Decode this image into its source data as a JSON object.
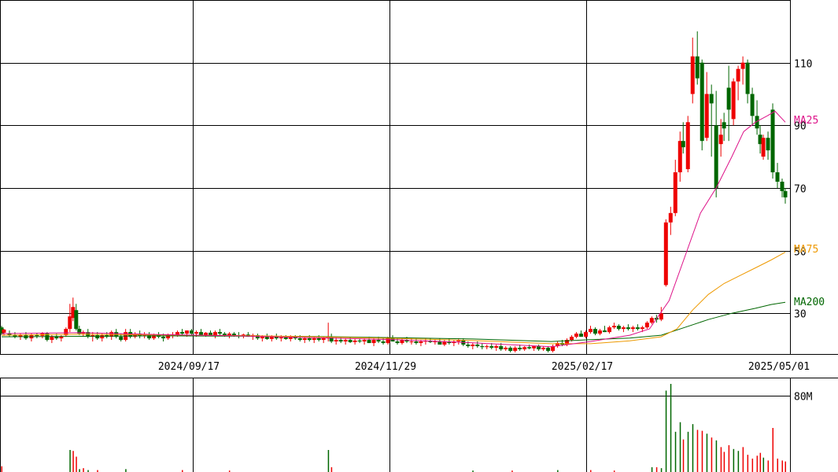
{
  "chart_data": {
    "type": "candlestick",
    "x_ticks": [
      "2024/09/17",
      "2024/11/29",
      "2025/02/17",
      "2025/05/01"
    ],
    "price_axis": {
      "ticks": [
        30,
        50,
        70,
        90,
        110
      ],
      "ylim": [
        17,
        130
      ]
    },
    "volume_axis": {
      "ticks": [
        "80M"
      ],
      "tick_values": [
        80
      ],
      "ylim": [
        0,
        92
      ]
    },
    "ma_labels": [
      "MA25",
      "MA75",
      "MA200"
    ],
    "colors": {
      "up": "#ee0000",
      "down": "#006600",
      "ma25": "#dd1188",
      "ma75": "#ee9900",
      "ma200": "#006600",
      "grid": "#000000"
    },
    "candles": [
      [
        0,
        25.5,
        26,
        23,
        23.5
      ],
      [
        3,
        23.8,
        25,
        22.8,
        24.8
      ],
      [
        10,
        23.5,
        24.5,
        22.5,
        23
      ],
      [
        17,
        23,
        24,
        22,
        22.5
      ],
      [
        24,
        22.5,
        23.5,
        21.5,
        23
      ],
      [
        31,
        23,
        24,
        21.5,
        22
      ],
      [
        38,
        22,
        23.5,
        21,
        23
      ],
      [
        45,
        23,
        23.8,
        22,
        22.8
      ],
      [
        52,
        22.8,
        24,
        22,
        23.5
      ],
      [
        58,
        23.5,
        24,
        21,
        21.5
      ],
      [
        64,
        21.5,
        23,
        20.5,
        22.5
      ],
      [
        70,
        22.5,
        23.5,
        21.5,
        22
      ],
      [
        76,
        22,
        23,
        21,
        22.5
      ],
      [
        82,
        23,
        25.5,
        22.5,
        25
      ],
      [
        87,
        25,
        33,
        24,
        29
      ],
      [
        91,
        28.5,
        35,
        27.5,
        32
      ],
      [
        95,
        31,
        33,
        24.5,
        25
      ],
      [
        99,
        25,
        26,
        23,
        23.5
      ],
      [
        104,
        23.5,
        24.5,
        22.5,
        24
      ],
      [
        110,
        24,
        25,
        22,
        22.5
      ],
      [
        116,
        22.5,
        24,
        21,
        23
      ],
      [
        122,
        23,
        24,
        21.5,
        22
      ],
      [
        128,
        22,
        23.5,
        21,
        23
      ],
      [
        134,
        23,
        24,
        22,
        22.5
      ],
      [
        140,
        22.5,
        24.5,
        21.5,
        24
      ],
      [
        146,
        24,
        25,
        22,
        22.5
      ],
      [
        152,
        22.5,
        23.5,
        21,
        21.5
      ],
      [
        158,
        21.5,
        25,
        21,
        24
      ],
      [
        164,
        24,
        25,
        22,
        22.5
      ],
      [
        170,
        22.5,
        24,
        22,
        23.5
      ],
      [
        176,
        23.5,
        24.5,
        22,
        22.8
      ],
      [
        182,
        22.8,
        24,
        22,
        23
      ],
      [
        188,
        23,
        24,
        21.5,
        22
      ],
      [
        194,
        22,
        23.5,
        21.5,
        23
      ],
      [
        200,
        23,
        24,
        22,
        22.5
      ],
      [
        206,
        22.5,
        23.5,
        21,
        22
      ],
      [
        212,
        22,
        23.5,
        21.5,
        23
      ],
      [
        218,
        23,
        24,
        22,
        23.2
      ],
      [
        224,
        23.2,
        24.5,
        22.5,
        24
      ],
      [
        230,
        24,
        25,
        23,
        23.5
      ],
      [
        236,
        23.5,
        24.5,
        22.5,
        24.5
      ],
      [
        242,
        24.5,
        25,
        23,
        23.5
      ],
      [
        248,
        23.5,
        24.5,
        22.5,
        24
      ],
      [
        254,
        24,
        25,
        23,
        23
      ],
      [
        260,
        23,
        24,
        22.5,
        23.8
      ],
      [
        266,
        23.8,
        24.5,
        22.8,
        23
      ],
      [
        272,
        23,
        24.5,
        22,
        24
      ],
      [
        278,
        24,
        25,
        23,
        23.5
      ],
      [
        284,
        23.5,
        24,
        22.5,
        22.8
      ],
      [
        290,
        22.8,
        24,
        22,
        23.5
      ],
      [
        296,
        23.5,
        24,
        22.5,
        23
      ],
      [
        302,
        23,
        24,
        22,
        22.8
      ],
      [
        308,
        22.8,
        23.5,
        22,
        23.2
      ],
      [
        314,
        23.2,
        24,
        22.5,
        22.5
      ],
      [
        320,
        22.5,
        23.5,
        21.5,
        23
      ],
      [
        326,
        23,
        23.5,
        21.5,
        22
      ],
      [
        332,
        22,
        23,
        21,
        22.5
      ],
      [
        338,
        22.5,
        23.5,
        21.5,
        21.8
      ],
      [
        344,
        21.8,
        23,
        21,
        22.5
      ],
      [
        350,
        22.5,
        23.5,
        21.5,
        22
      ],
      [
        356,
        22,
        23,
        21,
        22.3
      ],
      [
        362,
        22.3,
        23,
        21.5,
        21.8
      ],
      [
        368,
        21.8,
        23,
        21,
        22.5
      ],
      [
        374,
        22.5,
        23,
        21.5,
        22
      ],
      [
        380,
        22,
        23,
        21,
        21.5
      ],
      [
        386,
        21.5,
        22.5,
        20.5,
        22
      ],
      [
        392,
        22,
        23,
        21,
        21.5
      ],
      [
        398,
        21.5,
        22.5,
        20.5,
        22
      ],
      [
        404,
        22,
        23,
        21,
        21.5
      ],
      [
        410,
        21.5,
        22.5,
        20.5,
        22
      ],
      [
        416,
        22,
        27,
        21,
        22.5
      ],
      [
        420,
        22.5,
        23.5,
        20.5,
        21
      ],
      [
        426,
        21,
        22.5,
        20,
        21.5
      ],
      [
        432,
        21.5,
        22.5,
        20.5,
        21
      ],
      [
        438,
        21,
        22,
        20,
        21.5
      ],
      [
        444,
        21.5,
        22.5,
        20.5,
        20.8
      ],
      [
        450,
        20.8,
        22,
        20,
        21.3
      ],
      [
        456,
        21.3,
        22,
        20.5,
        21
      ],
      [
        462,
        21,
        22,
        20,
        21.5
      ],
      [
        468,
        21.5,
        22.5,
        20.5,
        20.5
      ],
      [
        474,
        20.5,
        22,
        19.5,
        21.5
      ],
      [
        480,
        21.5,
        22.5,
        20.5,
        21
      ],
      [
        486,
        21,
        22,
        20,
        20.5
      ],
      [
        492,
        20.5,
        22.5,
        20,
        22
      ],
      [
        498,
        22,
        23,
        21,
        21
      ],
      [
        504,
        21,
        22,
        20,
        20.5
      ],
      [
        510,
        20.5,
        22,
        20,
        21.5
      ],
      [
        516,
        21.5,
        22.5,
        20.5,
        21
      ],
      [
        522,
        21,
        22,
        20,
        21
      ],
      [
        528,
        21,
        22,
        20,
        20.5
      ],
      [
        534,
        20.5,
        21.5,
        19.5,
        21
      ],
      [
        540,
        21,
        22,
        20,
        21.2
      ],
      [
        546,
        21.2,
        22,
        20.5,
        20.8
      ],
      [
        552,
        20.8,
        21.5,
        20,
        21
      ],
      [
        558,
        21,
        22,
        20.5,
        20
      ],
      [
        564,
        20,
        21.5,
        19.5,
        21
      ],
      [
        570,
        21,
        22,
        20,
        20.5
      ],
      [
        576,
        20.5,
        21.5,
        19.5,
        21
      ],
      [
        582,
        21,
        22,
        20,
        21.5
      ],
      [
        588,
        21.5,
        22,
        19.5,
        20
      ],
      [
        594,
        20,
        21,
        19,
        19.5
      ],
      [
        600,
        19.5,
        20.5,
        18.5,
        20
      ],
      [
        606,
        20,
        21,
        19,
        19.5
      ],
      [
        612,
        19.5,
        20.5,
        18.5,
        19.2
      ],
      [
        618,
        19.2,
        20,
        18.5,
        19.5
      ],
      [
        624,
        19.5,
        20.5,
        18.5,
        19
      ],
      [
        630,
        19,
        20,
        18,
        19.5
      ],
      [
        636,
        19.5,
        20.5,
        18,
        18.5
      ],
      [
        642,
        18.5,
        19.5,
        18,
        19
      ],
      [
        648,
        19,
        19.5,
        17.5,
        18
      ],
      [
        654,
        18,
        19.5,
        17.5,
        19
      ],
      [
        660,
        19,
        20,
        18,
        18.5
      ],
      [
        666,
        18.5,
        19.5,
        18,
        19.2
      ],
      [
        672,
        19.2,
        20,
        18.5,
        18.8
      ],
      [
        678,
        18.8,
        19.5,
        18,
        19.5
      ],
      [
        684,
        19.5,
        20,
        18,
        18.5
      ],
      [
        690,
        18.5,
        19.5,
        18,
        19
      ],
      [
        696,
        19,
        19.5,
        17.5,
        18
      ],
      [
        702,
        18,
        20,
        17.5,
        19.5
      ],
      [
        708,
        19.5,
        21,
        19,
        20.5
      ],
      [
        714,
        20.5,
        21.5,
        19.5,
        20
      ],
      [
        720,
        20,
        22,
        19.5,
        21.5
      ],
      [
        726,
        21.5,
        23,
        21,
        22.5
      ],
      [
        732,
        22.5,
        24,
        22,
        23.5
      ],
      [
        738,
        23.5,
        24.5,
        22.5,
        22.5
      ],
      [
        744,
        22.5,
        24.5,
        22,
        24
      ],
      [
        750,
        24,
        26,
        23.5,
        25
      ],
      [
        756,
        25,
        25.5,
        23,
        23.5
      ],
      [
        762,
        23.5,
        25,
        23,
        24.5
      ],
      [
        768,
        24.5,
        26,
        24,
        24
      ],
      [
        774,
        24,
        26,
        23.5,
        25.5
      ],
      [
        780,
        25.5,
        27,
        25,
        26
      ],
      [
        786,
        26,
        26.5,
        24.5,
        25
      ],
      [
        792,
        25,
        26,
        24,
        25.5
      ],
      [
        798,
        25.5,
        26.5,
        24.5,
        25
      ],
      [
        804,
        25,
        26,
        24,
        25.5
      ],
      [
        810,
        25.5,
        26.5,
        24.5,
        25
      ],
      [
        816,
        25,
        26,
        24,
        25.5
      ],
      [
        822,
        25.5,
        27.5,
        25,
        27
      ],
      [
        828,
        27,
        29,
        26.5,
        28.5
      ],
      [
        834,
        28.5,
        29.5,
        27,
        28
      ],
      [
        840,
        28,
        32,
        27.5,
        30
      ],
      [
        846,
        39,
        60,
        38.5,
        59
      ],
      [
        852,
        59,
        64,
        55,
        62
      ],
      [
        858,
        62,
        79,
        61,
        75
      ],
      [
        864,
        75,
        88,
        72,
        85
      ],
      [
        868,
        85,
        91,
        81,
        83
      ],
      [
        874,
        76,
        93,
        75,
        91
      ],
      [
        880,
        100,
        118,
        97,
        112
      ],
      [
        886,
        112,
        120,
        103,
        105
      ],
      [
        892,
        110,
        111,
        82,
        85
      ],
      [
        898,
        86,
        107,
        85,
        100
      ],
      [
        904,
        100,
        103,
        80,
        97
      ],
      [
        910,
        90,
        101,
        67,
        70
      ],
      [
        916,
        84,
        92,
        80,
        87
      ],
      [
        920,
        91,
        94,
        85,
        89
      ],
      [
        926,
        102,
        109,
        85,
        95
      ],
      [
        932,
        92,
        105,
        90,
        104
      ],
      [
        938,
        104,
        109,
        98,
        108
      ],
      [
        944,
        108,
        112,
        103,
        110
      ],
      [
        950,
        110,
        111,
        97,
        100
      ],
      [
        956,
        100,
        102,
        90,
        93
      ],
      [
        962,
        93,
        98,
        87,
        89
      ],
      [
        966,
        87,
        90,
        81,
        84
      ],
      [
        970,
        80,
        87,
        79,
        86
      ],
      [
        976,
        86,
        88,
        79,
        82
      ],
      [
        982,
        95,
        97,
        73,
        75
      ],
      [
        988,
        75,
        78,
        70,
        72
      ],
      [
        994,
        72,
        73,
        67,
        69
      ],
      [
        998,
        69,
        70,
        65,
        67
      ]
    ],
    "ma25": [
      [
        0,
        23.5
      ],
      [
        100,
        23.8
      ],
      [
        200,
        23.2
      ],
      [
        300,
        22.8
      ],
      [
        400,
        22.2
      ],
      [
        500,
        21.6
      ],
      [
        600,
        20.6
      ],
      [
        700,
        19.3
      ],
      [
        750,
        21
      ],
      [
        800,
        23
      ],
      [
        825,
        25
      ],
      [
        850,
        34
      ],
      [
        870,
        48
      ],
      [
        890,
        62
      ],
      [
        910,
        70
      ],
      [
        930,
        80
      ],
      [
        945,
        88
      ],
      [
        960,
        91
      ],
      [
        975,
        93
      ],
      [
        985,
        94.5
      ],
      [
        998,
        91
      ]
    ],
    "ma75": [
      [
        0,
        23
      ],
      [
        100,
        23.3
      ],
      [
        200,
        23.1
      ],
      [
        300,
        22.9
      ],
      [
        400,
        22.5
      ],
      [
        500,
        22
      ],
      [
        600,
        21.3
      ],
      [
        700,
        20.3
      ],
      [
        750,
        20.3
      ],
      [
        800,
        21.2
      ],
      [
        840,
        22.5
      ],
      [
        860,
        25
      ],
      [
        880,
        31
      ],
      [
        900,
        36
      ],
      [
        920,
        39.5
      ],
      [
        940,
        42
      ],
      [
        960,
        44.5
      ],
      [
        980,
        47
      ],
      [
        998,
        49.5
      ]
    ],
    "ma200": [
      [
        0,
        22.5
      ],
      [
        200,
        22.8
      ],
      [
        400,
        22.6
      ],
      [
        600,
        21.8
      ],
      [
        700,
        21
      ],
      [
        750,
        21.6
      ],
      [
        800,
        22.1
      ],
      [
        840,
        23
      ],
      [
        870,
        25.5
      ],
      [
        900,
        28
      ],
      [
        930,
        30
      ],
      [
        960,
        31.6
      ],
      [
        980,
        32.8
      ],
      [
        998,
        33.5
      ]
    ],
    "volume": [
      [
        0,
        6,
        "u"
      ],
      [
        87,
        23,
        "d"
      ],
      [
        91,
        22,
        "u"
      ],
      [
        95,
        16,
        "u"
      ],
      [
        99,
        3,
        "d"
      ],
      [
        104,
        4,
        "u"
      ],
      [
        110,
        2,
        "d"
      ],
      [
        122,
        2,
        "u"
      ],
      [
        158,
        3,
        "d"
      ],
      [
        230,
        2,
        "u"
      ],
      [
        290,
        1.5,
        "u"
      ],
      [
        416,
        23,
        "d"
      ],
      [
        420,
        5,
        "u"
      ],
      [
        600,
        1.5,
        "d"
      ],
      [
        650,
        1.5,
        "u"
      ],
      [
        708,
        2,
        "d"
      ],
      [
        750,
        2,
        "u"
      ],
      [
        780,
        1.5,
        "u"
      ],
      [
        828,
        5,
        "d"
      ],
      [
        834,
        5,
        "u"
      ],
      [
        840,
        4,
        "d"
      ],
      [
        846,
        85,
        "d"
      ],
      [
        852,
        92,
        "d"
      ],
      [
        858,
        42,
        "d"
      ],
      [
        864,
        52,
        "d"
      ],
      [
        868,
        34,
        "u"
      ],
      [
        874,
        42,
        "d"
      ],
      [
        880,
        50,
        "d"
      ],
      [
        886,
        44,
        "u"
      ],
      [
        892,
        43,
        "u"
      ],
      [
        898,
        40,
        "d"
      ],
      [
        904,
        36,
        "u"
      ],
      [
        910,
        33,
        "d"
      ],
      [
        916,
        26,
        "u"
      ],
      [
        920,
        21,
        "u"
      ],
      [
        926,
        28,
        "u"
      ],
      [
        932,
        24,
        "d"
      ],
      [
        938,
        22,
        "d"
      ],
      [
        944,
        26,
        "u"
      ],
      [
        950,
        18,
        "u"
      ],
      [
        956,
        14,
        "u"
      ],
      [
        962,
        17,
        "u"
      ],
      [
        966,
        20,
        "u"
      ],
      [
        970,
        15,
        "d"
      ],
      [
        976,
        12,
        "u"
      ],
      [
        982,
        46,
        "u"
      ],
      [
        988,
        14,
        "u"
      ],
      [
        994,
        12,
        "u"
      ],
      [
        998,
        11,
        "u"
      ]
    ]
  }
}
